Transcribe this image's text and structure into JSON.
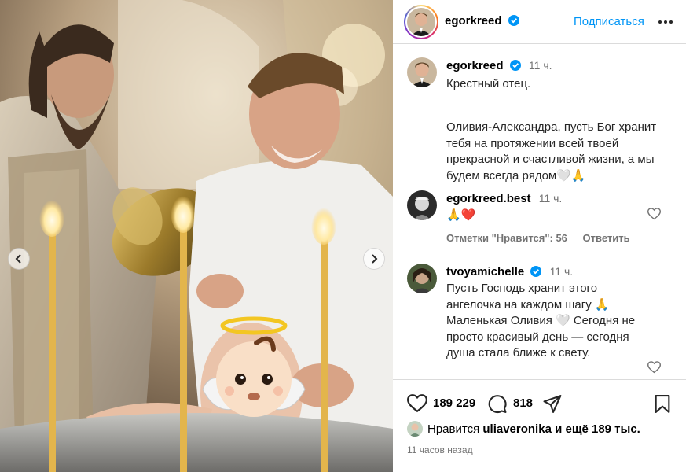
{
  "post": {
    "author": "egorkreed",
    "follow_label": "Подписаться"
  },
  "caption": {
    "author": "egorkreed",
    "time": "11 ч.",
    "line1": "Крестный отец.",
    "text": "Оливия-Александра, пусть Бог хранит тебя на протяжении всей твоей прекрасной и счастливой жизни, а мы будем всегда рядом🤍🙏"
  },
  "comments": [
    {
      "author": "egorkreed.best",
      "time": "11 ч.",
      "text": "🙏❤️",
      "likes_label": "Отметки \"Нравится\": 56",
      "reply_label": "Ответить"
    },
    {
      "author": "tvoyamichelle",
      "time": "11 ч.",
      "text": "Пусть Господь хранит этого ангелочка на каждом шагу 🙏 Маленькая Оливия 🤍 Сегодня не просто красивый день — сегодня душа стала ближе к свету."
    }
  ],
  "actions": {
    "like_count": "189 229",
    "comment_count": "818"
  },
  "likes": {
    "prefix": "Нравится",
    "user": "uliaveronika",
    "suffix": "и ещё 189 тыс."
  },
  "posted_ago": "11 часов назад",
  "colors": {
    "accent": "#0095f6",
    "verified": "#0095f6",
    "muted": "#737373",
    "heart_red": "#ed4956"
  },
  "icons": [
    "chevron-left-icon",
    "chevron-right-icon",
    "more-icon",
    "heart-icon",
    "comment-icon",
    "share-icon",
    "bookmark-icon",
    "verified-icon"
  ]
}
